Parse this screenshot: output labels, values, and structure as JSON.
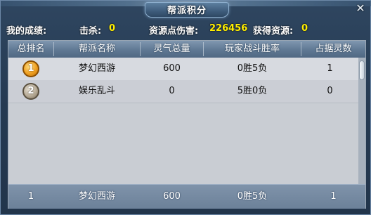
{
  "window": {
    "title": "帮派积分",
    "close_glyph": "✕"
  },
  "stats": {
    "my_score_label": "我的成绩:",
    "kills_label": "击杀:",
    "kills_value": "0",
    "damage_label": "资源点伤害:",
    "damage_value": "226456",
    "resources_label": "获得资源:",
    "resources_value": "0"
  },
  "table": {
    "headers": [
      "总排名",
      "帮派名称",
      "灵气总量",
      "玩家战斗胜率",
      "占据灵数"
    ],
    "rows": [
      {
        "rank": "1",
        "rank_icon": "gold-rank-badge-icon",
        "name": "梦幻西游",
        "qi": "600",
        "win_rate": "0胜5负",
        "occupied": "1"
      },
      {
        "rank": "2",
        "rank_icon": "silver-rank-badge-icon",
        "name": "娱乐乱斗",
        "qi": "0",
        "win_rate": "5胜0负",
        "occupied": "0"
      }
    ],
    "my_row": {
      "rank": "1",
      "name": "梦幻西游",
      "qi": "600",
      "win_rate": "0胜5负",
      "occupied": "1"
    }
  },
  "colors": {
    "value_highlight": "#ffee00",
    "gold_badge": "#f0a020",
    "silver_badge": "#b7ab96"
  }
}
